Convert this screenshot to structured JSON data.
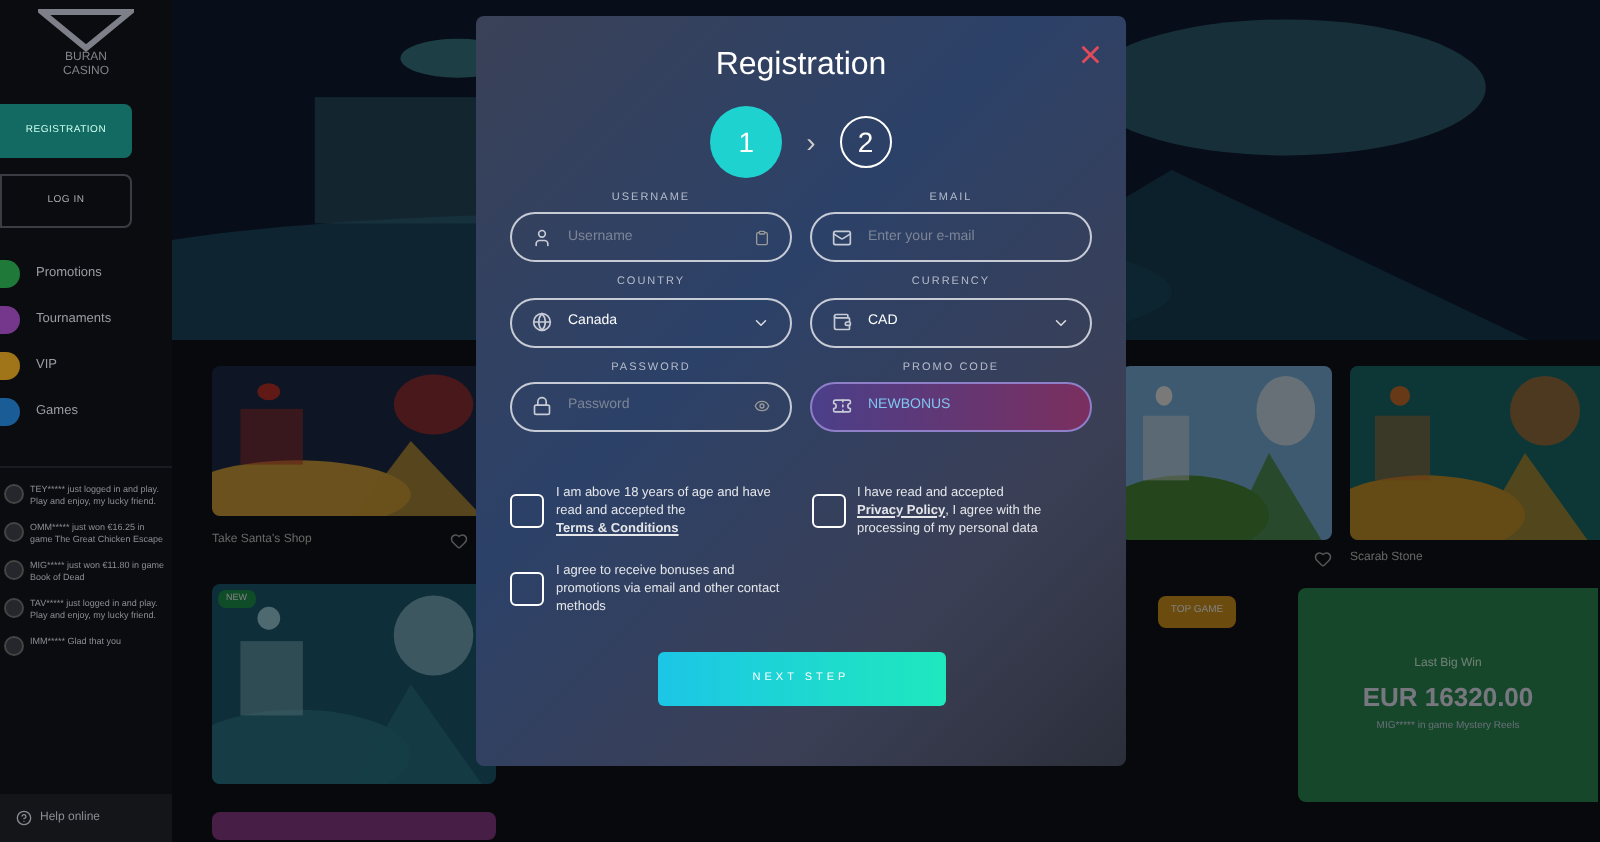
{
  "sidebar": {
    "logo_text": "BURAN CASINO",
    "buttons": [
      {
        "label": "REGISTRATION",
        "kind": "primary"
      },
      {
        "label": "LOG IN",
        "kind": "outline"
      }
    ],
    "nav": [
      {
        "label": "Promotions",
        "color": "#1f7a3a"
      },
      {
        "label": "Tournaments",
        "color": "#74378c"
      },
      {
        "label": "VIP",
        "color": "#a07418"
      },
      {
        "label": "Games",
        "color": "#1a5c96"
      }
    ],
    "feed": [
      {
        "text": "TEY***** just logged in and play. Play and enjoy, my lucky friend."
      },
      {
        "text": "OMM***** just won €16.25 in game The Great Chicken Escape"
      },
      {
        "text": "MIG***** just won €11.80 in game Book of Dead"
      },
      {
        "text": "TAV***** just logged in and play. Play and enjoy, my lucky friend."
      },
      {
        "text": "IMM***** Glad that you"
      }
    ],
    "help": "Help online"
  },
  "games": [
    {
      "title": "Take Santa's Shop"
    },
    {
      "badge": "NEW"
    },
    {
      "title": "Scarab Stone"
    }
  ],
  "top_game_badge": "TOP GAME",
  "big_win": {
    "title": "Last Big Win",
    "amount": "EUR 16320.00",
    "detail": "MIG***** in game Mystery Reels"
  },
  "registration": {
    "title": "Registration",
    "close": "×",
    "step_separator": "›",
    "steps": [
      {
        "label": "1",
        "selected": true
      },
      {
        "label": "2",
        "selected": false
      }
    ],
    "fields": [
      {
        "label": "USERNAME",
        "placeholder": "Username",
        "kind": "text"
      },
      {
        "label": "EMAIL",
        "placeholder": "Enter your e-mail",
        "kind": "text"
      },
      {
        "label": "COUNTRY",
        "value": "Canada",
        "kind": "select"
      },
      {
        "label": "CURRENCY",
        "value": "CAD",
        "kind": "select"
      },
      {
        "label": "PASSWORD",
        "placeholder": "Password",
        "kind": "text"
      },
      {
        "label": "PROMO CODE",
        "value": "NEWBONUS",
        "kind": "promo"
      }
    ],
    "consents": [
      {
        "before": "I am above 18 years of age and have read and accepted the ",
        "link": "Terms & Conditions",
        "checked": false
      },
      {
        "before": "I have read and accepted ",
        "link": "Privacy Policy",
        "after": ", I agree with the processing of my personal data",
        "checked": false
      },
      {
        "before": "I agree to receive bonuses and promotions via email and other contact methods",
        "checked": false
      }
    ],
    "submit": "NEXT STEP"
  }
}
